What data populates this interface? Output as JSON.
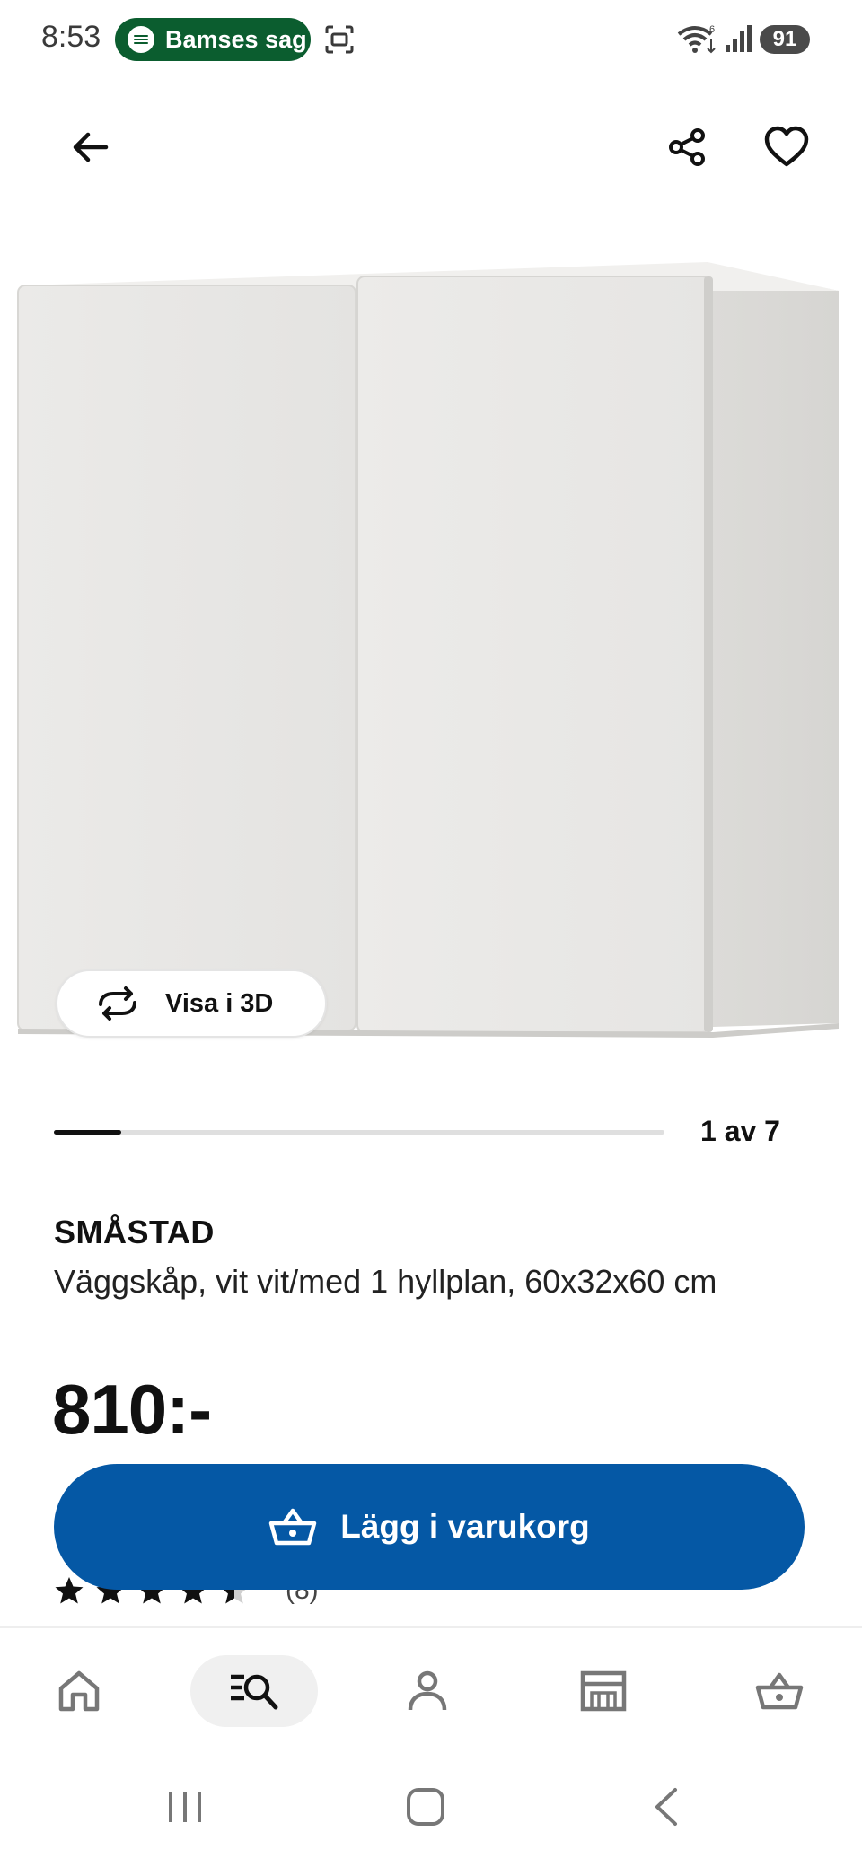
{
  "status_bar": {
    "time": "8:53",
    "media_title": "Bamses sag",
    "battery": "91"
  },
  "gallery": {
    "view_3d_label": "Visa i 3D",
    "position_label": "1 av 7",
    "progress": 0.11
  },
  "product": {
    "name": "SMÅSTAD",
    "description": "Väggskåp, vit vit/med 1 hyllplan, 60x32x60 cm",
    "price": "810:-",
    "rating_count": "(8)",
    "rating_stars": 4.5
  },
  "actions": {
    "add_to_cart_label": "Lägg i varukorg"
  },
  "bottom_nav": {
    "items": [
      {
        "icon": "home-icon",
        "active": false
      },
      {
        "icon": "search-list-icon",
        "active": true
      },
      {
        "icon": "profile-icon",
        "active": false
      },
      {
        "icon": "store-icon",
        "active": false
      },
      {
        "icon": "cart-icon",
        "active": false
      }
    ]
  },
  "colors": {
    "primary_button": "#0558a5",
    "media_pill": "#0b5d2f"
  }
}
